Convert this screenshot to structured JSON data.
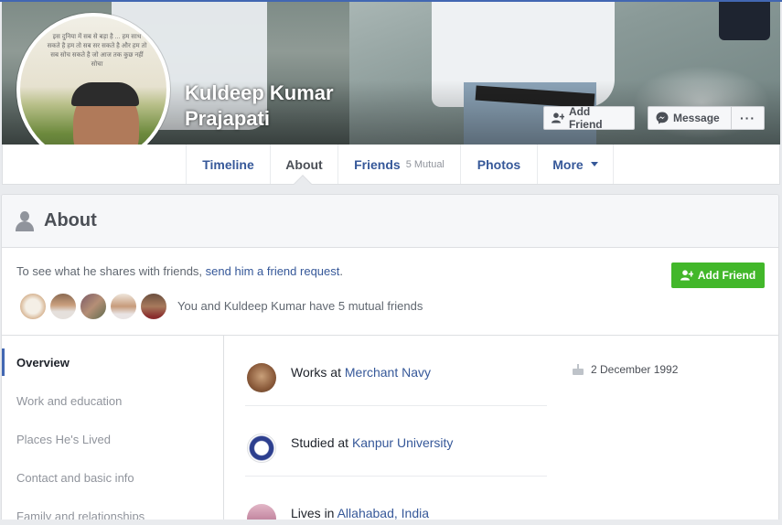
{
  "cover": {
    "name_line1": "Kuldeep Kumar",
    "name_line2": "Prajapati",
    "add_friend_label": "Add Friend",
    "message_label": "Message",
    "more_label": "···"
  },
  "avatar": {
    "caption": "इस दुनिया में सब से बड़ा है ... हम साथ सकते है हम तो सब सर सकते है और हम तो सब सोच सकते है जो आज तक कुछ नहीं सोचा"
  },
  "nav": {
    "tabs": [
      {
        "label": "Timeline"
      },
      {
        "label": "About"
      },
      {
        "label": "Friends",
        "sub": "5 Mutual"
      },
      {
        "label": "Photos"
      },
      {
        "label": "More"
      }
    ]
  },
  "about": {
    "title": "About",
    "friend_prompt_prefix": "To see what he shares with friends, ",
    "friend_prompt_link": "send him a friend request",
    "friend_prompt_suffix": ".",
    "add_friend_label": "Add Friend",
    "mutual_text": "You and Kuldeep Kumar have 5 mutual friends",
    "sidebar": [
      {
        "label": "Overview"
      },
      {
        "label": "Work and education"
      },
      {
        "label": "Places He's Lived"
      },
      {
        "label": "Contact and basic info"
      },
      {
        "label": "Family and relationships"
      }
    ],
    "overview": {
      "work_prefix": "Works at ",
      "work_link": "Merchant Navy",
      "study_prefix": "Studied at ",
      "study_link": "Kanpur University",
      "lives_prefix": "Lives in ",
      "lives_link": "Allahabad, India",
      "birthday": "2 December 1992"
    }
  },
  "colors": {
    "fb_blue": "#4267b2",
    "link": "#365899",
    "green": "#42b72a"
  }
}
